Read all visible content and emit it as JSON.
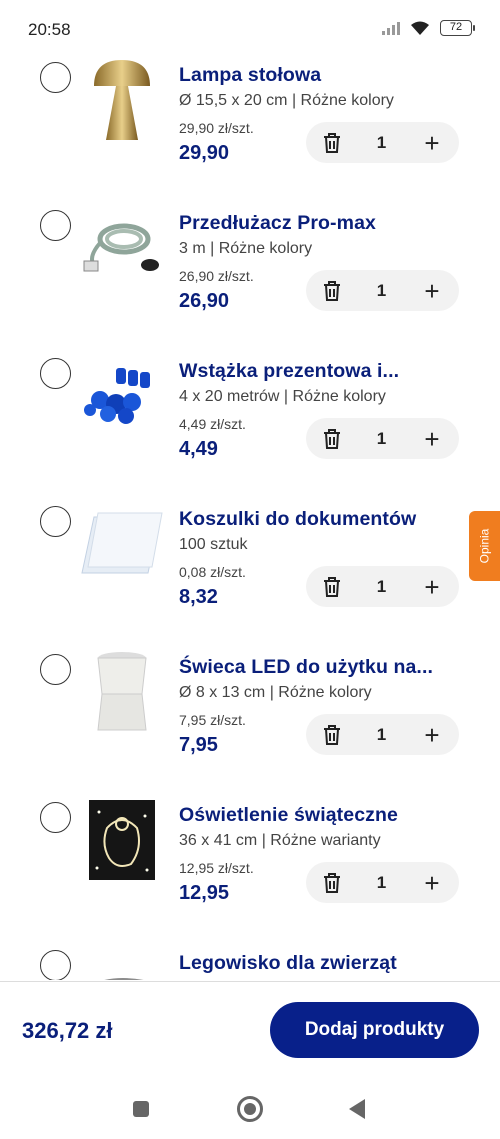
{
  "status": {
    "time": "20:58",
    "battery": "72"
  },
  "colors": {
    "brand": "#0a1f7a",
    "button": "#08208a",
    "feedback_tab": "#f07d1f"
  },
  "items": [
    {
      "name": "Lampa stołowa",
      "desc": "Ø 15,5 x 20 cm | Różne kolory",
      "unit_price": "29,90 zł/szt.",
      "price": "29,90",
      "qty": "1"
    },
    {
      "name": "Przedłużacz Pro-max",
      "desc": "3 m | Różne kolory",
      "unit_price": "26,90 zł/szt.",
      "price": "26,90",
      "qty": "1"
    },
    {
      "name": "Wstążka prezentowa i...",
      "desc": "4 x 20 metrów | Różne kolory",
      "unit_price": "4,49 zł/szt.",
      "price": "4,49",
      "qty": "1"
    },
    {
      "name": "Koszulki do dokumentów",
      "desc": "100 sztuk",
      "unit_price": "0,08 zł/szt.",
      "price": "8,32",
      "qty": "1"
    },
    {
      "name": "Świeca LED do użytku na...",
      "desc": "Ø 8 x 13 cm | Różne kolory",
      "unit_price": "7,95 zł/szt.",
      "price": "7,95",
      "qty": "1"
    },
    {
      "name": "Oświetlenie świąteczne",
      "desc": "36 x 41 cm | Różne warianty",
      "unit_price": "12,95 zł/szt.",
      "price": "12,95",
      "qty": "1"
    },
    {
      "name": "Legowisko dla zwierząt",
      "desc": "",
      "unit_price": "",
      "price": "",
      "qty": ""
    }
  ],
  "feedback_tab": "Opinia",
  "footer": {
    "total": "326,72 zł",
    "add_button": "Dodaj produkty"
  }
}
